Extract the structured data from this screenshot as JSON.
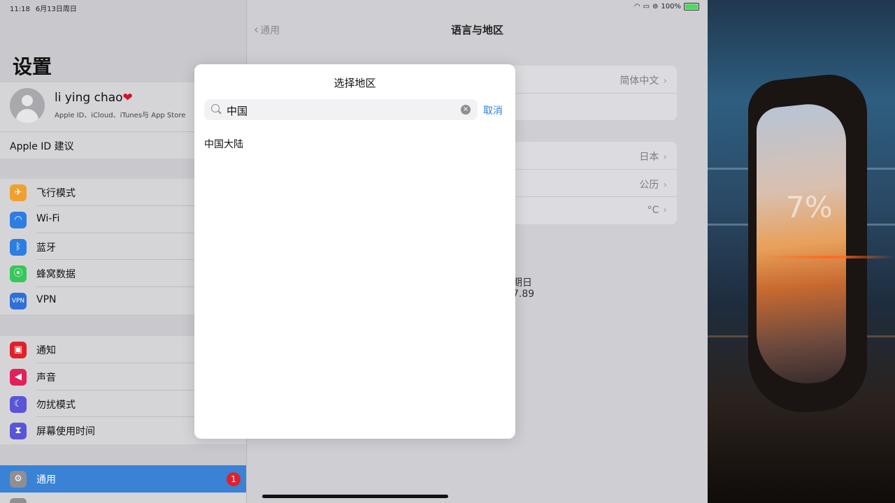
{
  "status": {
    "time": "11:18",
    "date": "6月13日周日",
    "battery": "100%"
  },
  "sidebar": {
    "title": "设置",
    "profile": {
      "name": "li ying chao",
      "sub": "Apple ID、iCloud、iTunes与 App Store"
    },
    "apple_id_suggest": "Apple ID 建议",
    "group1": [
      {
        "label": "飞行模式",
        "icon": "airplane-icon",
        "color": "#f0a030"
      },
      {
        "label": "Wi-Fi",
        "icon": "wifi-icon",
        "color": "#2f7de1"
      },
      {
        "label": "蓝牙",
        "icon": "bluetooth-icon",
        "color": "#2f7de1"
      },
      {
        "label": "蜂窝数据",
        "icon": "cellular-icon",
        "color": "#35c759"
      },
      {
        "label": "VPN",
        "icon": "vpn-icon",
        "color": "#2f6fd8"
      }
    ],
    "group2": [
      {
        "label": "通知",
        "icon": "notification-icon",
        "color": "#e0212a"
      },
      {
        "label": "声音",
        "icon": "sound-icon",
        "color": "#e0215a"
      },
      {
        "label": "勿扰模式",
        "icon": "moon-icon",
        "color": "#5856d6"
      },
      {
        "label": "屏幕使用时间",
        "icon": "hourglass-icon",
        "color": "#5856d6"
      }
    ],
    "group3": [
      {
        "label": "通用",
        "icon": "gear-icon",
        "color": "#8e8e93",
        "badge": "1"
      }
    ]
  },
  "detail": {
    "back_label": "通用",
    "title": "语言与地区",
    "card1": [
      "简体中文",
      ""
    ],
    "card2": [
      "日本",
      "公历",
      "°C"
    ],
    "fragments": [
      "期日",
      "7.89"
    ]
  },
  "modal": {
    "title": "选择地区",
    "search_value": "中国",
    "cancel": "取消",
    "results": [
      "中国大陆"
    ]
  },
  "wallpaper": {
    "text": "7%"
  }
}
